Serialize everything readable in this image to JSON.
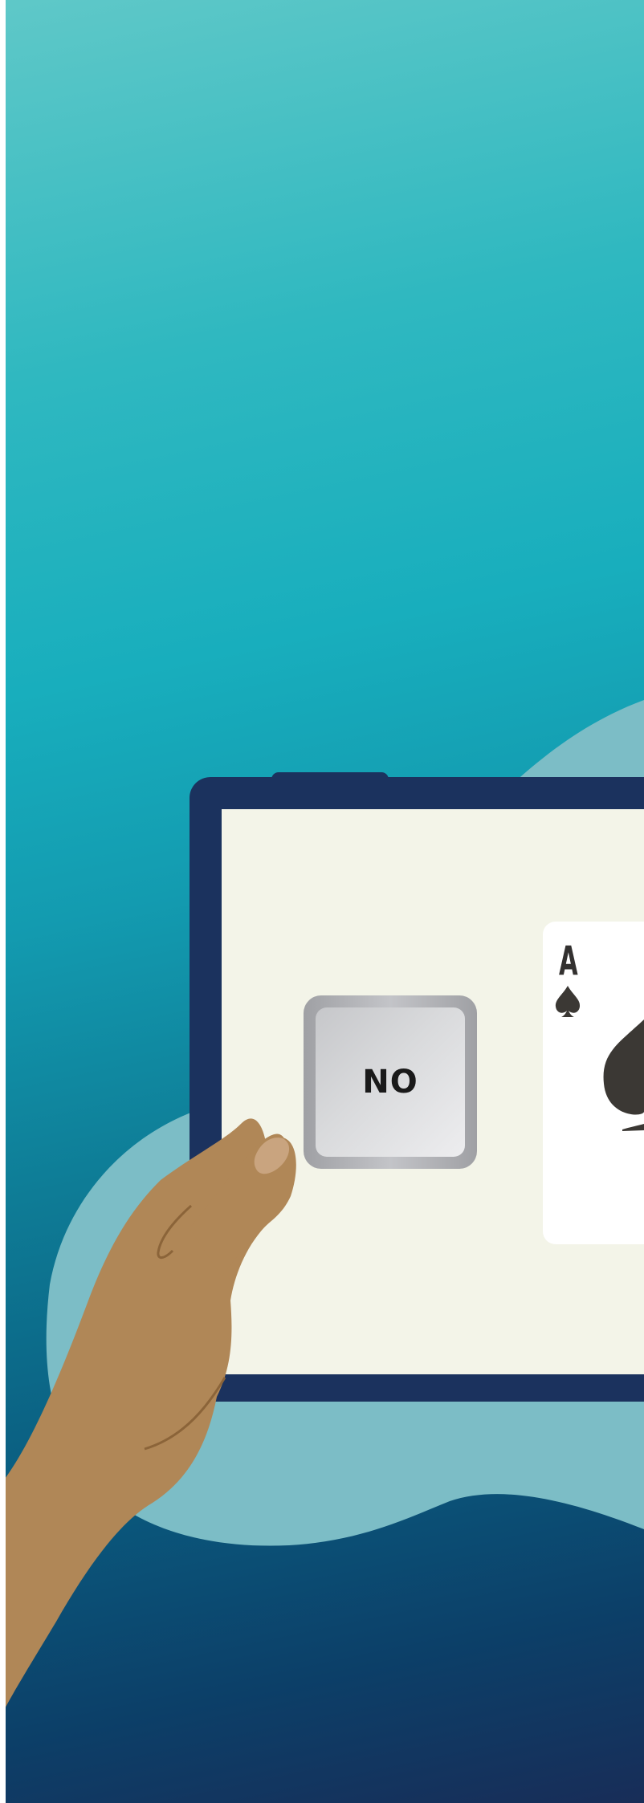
{
  "scene": {
    "no_button": {
      "label": "NO"
    },
    "card": {
      "rank": "A",
      "suit": "spades"
    }
  },
  "colors": {
    "tablet_frame": "#1b325e",
    "screen": "#f3f4e8",
    "blob": "#7cbdc6",
    "hand": "#b08757",
    "hand_line": "#8b6439",
    "thumbnail": "#c9a47f",
    "card": "#ffffff",
    "suit": "#3b3834",
    "button_face": "#d9dadc",
    "button_rim": "#a6a7ab"
  }
}
